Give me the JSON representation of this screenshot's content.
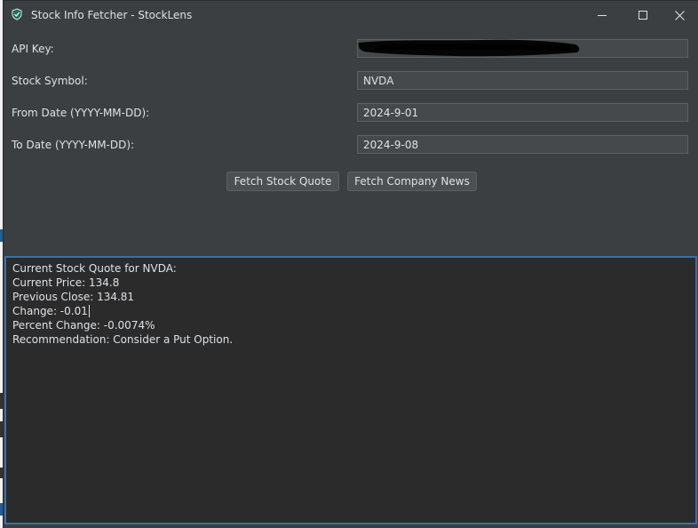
{
  "window": {
    "title": "Stock Info Fetcher - StockLens",
    "app_icon": "shield-icon",
    "controls": [
      "minimize-icon",
      "maximize-icon",
      "close-icon"
    ]
  },
  "form": {
    "api_key": {
      "label": "API Key:",
      "value": "",
      "redacted": true
    },
    "symbol": {
      "label": "Stock Symbol:",
      "value": "NVDA"
    },
    "from_date": {
      "label": "From Date (YYYY-MM-DD):",
      "value": "2024-9-01"
    },
    "to_date": {
      "label": "To Date (YYYY-MM-DD):",
      "value": "2024-9-08"
    }
  },
  "buttons": {
    "fetch_quote": "Fetch Stock Quote",
    "fetch_news": "Fetch Company News"
  },
  "output": {
    "lines": [
      "Current Stock Quote for NVDA:",
      "Current Price: 134.8",
      "Previous Close: 134.81",
      "Change: -0.01",
      "Percent Change: -0.0074%",
      "Recommendation: Consider a Put Option."
    ]
  },
  "colors": {
    "window_bg": "#3c3f41",
    "field_bg": "#45494a",
    "output_bg": "#2b2b2b",
    "focus_border": "#3d6fa6",
    "text": "#dfe1e5"
  }
}
